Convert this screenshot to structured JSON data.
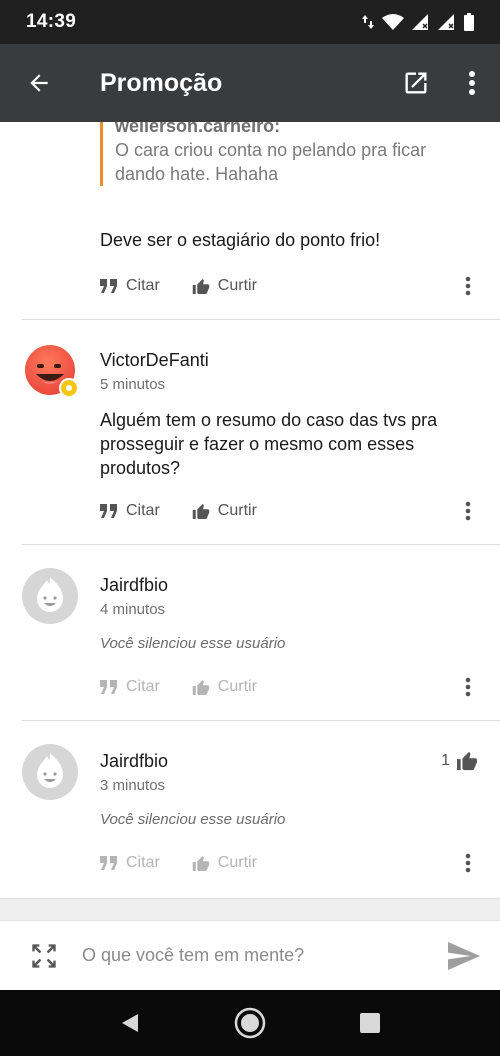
{
  "status_bar": {
    "time": "14:39"
  },
  "header": {
    "title": "Promoção"
  },
  "quote": {
    "author": "wellerson.carneiro:",
    "text": "O cara criou conta no pelando pra ficar dando hate. Hahaha"
  },
  "comments": [
    {
      "text": "Deve ser o estagiário do ponto frio!",
      "actions": {
        "quote": "Citar",
        "like": "Curtir"
      }
    },
    {
      "username": "VictorDeFanti",
      "time": "5 minutos",
      "text": "Alguém tem o resumo do caso das tvs pra prosseguir e fazer o mesmo com esses produtos?",
      "actions": {
        "quote": "Citar",
        "like": "Curtir"
      }
    },
    {
      "username": "Jairdfbio",
      "time": "4 minutos",
      "muted_text": "Você silenciou esse usuário",
      "actions": {
        "quote": "Citar",
        "like": "Curtir"
      }
    },
    {
      "username": "Jairdfbio",
      "time": "3 minutos",
      "likes": "1",
      "muted_text": "Você silenciou esse usuário",
      "actions": {
        "quote": "Citar",
        "like": "Curtir"
      }
    }
  ],
  "composer": {
    "placeholder": "O que você tem em mente?"
  },
  "colors": {
    "app_bar": "#3a3b3c",
    "status_bar": "#202020",
    "quote_border": "#e8912c",
    "angry_avatar": "#e8443a",
    "badge": "#f5c518"
  },
  "icons": {
    "back": "arrow-left-icon",
    "open_external": "open-external-icon",
    "overflow": "more-vertical-icon",
    "quote": "quote-icon",
    "like": "thumbs-up-icon",
    "expand": "expand-icon",
    "send": "send-icon"
  }
}
